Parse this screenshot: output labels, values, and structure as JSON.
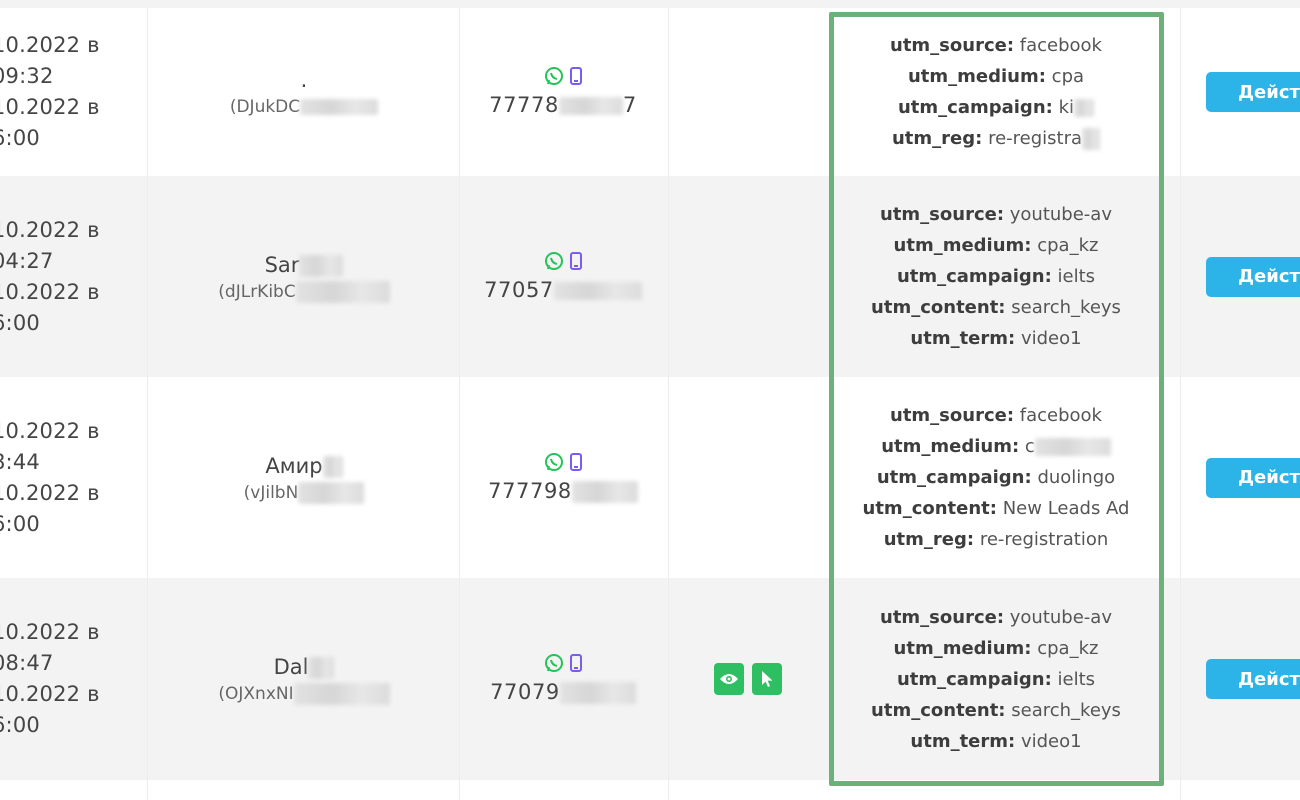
{
  "table": {
    "rows": [
      {
        "dates": [
          "10.2022 в",
          "09:32",
          "10.2022 в",
          "6:00"
        ],
        "client_name": ".",
        "client_login": "(DJukDC",
        "phone": "77778",
        "phone_tail": "7",
        "utm": [
          {
            "key": "utm_source:",
            "value": "facebook"
          },
          {
            "key": "utm_medium:",
            "value": "cpa"
          },
          {
            "key": "utm_campaign:",
            "value": "ki"
          },
          {
            "key": "utm_reg:",
            "value": "re-registra"
          }
        ],
        "action_label": "Действ"
      },
      {
        "dates": [
          "10.2022 в",
          "04:27",
          "10.2022 в",
          "6:00"
        ],
        "client_name": "Sar",
        "client_login": "(dJLrKibC",
        "phone": "77057",
        "phone_tail": "",
        "utm": [
          {
            "key": "utm_source:",
            "value": "youtube-av"
          },
          {
            "key": "utm_medium:",
            "value": "cpa_kz"
          },
          {
            "key": "utm_campaign:",
            "value": "ielts"
          },
          {
            "key": "utm_content:",
            "value": "search_keys"
          },
          {
            "key": "utm_term:",
            "value": "video1"
          }
        ],
        "action_label": "Действ"
      },
      {
        "dates": [
          "10.2022 в",
          "8:44",
          "10.2022 в",
          "6:00"
        ],
        "client_name": "Амир",
        "client_login": "(vJilbN",
        "phone": "777798",
        "phone_tail": "",
        "utm": [
          {
            "key": "utm_source:",
            "value": "facebook"
          },
          {
            "key": "utm_medium:",
            "value": "c"
          },
          {
            "key": "utm_campaign:",
            "value": "duolingo"
          },
          {
            "key": "utm_content:",
            "value": "New Leads Ad"
          },
          {
            "key": "utm_reg:",
            "value": "re-registration"
          }
        ],
        "action_label": "Действ"
      },
      {
        "dates": [
          "10.2022 в",
          "08:47",
          "10.2022 в",
          "6:00"
        ],
        "client_name": "Dal",
        "client_login": "(OJXnxNI",
        "phone": "77079",
        "phone_tail": "",
        "utm": [
          {
            "key": "utm_source:",
            "value": "youtube-av"
          },
          {
            "key": "utm_medium:",
            "value": "cpa_kz"
          },
          {
            "key": "utm_campaign:",
            "value": "ielts"
          },
          {
            "key": "utm_content:",
            "value": "search_keys"
          },
          {
            "key": "utm_term:",
            "value": "video1"
          }
        ],
        "action_label": "Действ"
      }
    ]
  },
  "colors": {
    "action_button": "#2cb4e8",
    "highlight_border": "#6db07a",
    "icon_button": "#2fbf63",
    "whatsapp_icon": "#25c35a",
    "mobile_icon": "#7a5cf0"
  },
  "icons": [
    "whatsapp-icon",
    "mobile-phone-icon",
    "eye-icon",
    "cursor-icon"
  ]
}
